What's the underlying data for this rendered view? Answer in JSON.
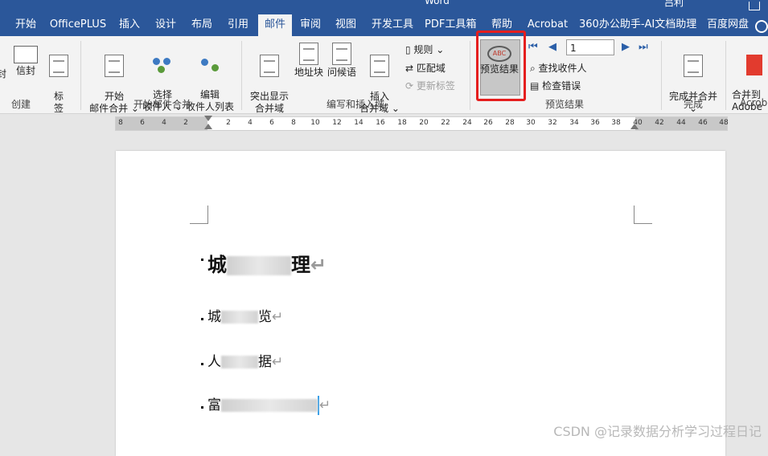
{
  "titlebar": {
    "doc_name": "Word",
    "user": "吕利"
  },
  "tabs": [
    "开始",
    "OfficePLUS",
    "插入",
    "设计",
    "布局",
    "引用",
    "邮件",
    "审阅",
    "视图",
    "开发工具",
    "PDF工具箱",
    "帮助",
    "Acrobat",
    "360办公助手-AI文档助理",
    "百度网盘"
  ],
  "active_tab": "邮件",
  "ribbon": {
    "create_group": {
      "label": "创建",
      "envelope": "信封",
      "labels_btn": "标\n签",
      "partial": "封"
    },
    "start_merge_group": {
      "label": "开始邮件合并",
      "start_merge": "开始\n邮件合并 ⌄",
      "select_recipients": "选择\n收件人 ⌄",
      "edit_list": "编辑\n收件人列表"
    },
    "write_insert_group": {
      "label": "编写和插入域",
      "highlight": "突出显示\n合并域",
      "address_block": "地址块",
      "greeting": "问候语",
      "insert_field": "插入\n合并域 ⌄",
      "rules": "规则 ⌄",
      "match_fields": "匹配域",
      "update_labels": "更新标签"
    },
    "preview_group": {
      "label": "预览结果",
      "preview_btn": "预览结果",
      "record": "1",
      "find_recipient": "查找收件人",
      "check_errors": "检查错误"
    },
    "finish_group": {
      "label": "完成",
      "finish_merge": "完成并合并\n⌄"
    },
    "adobe_group": {
      "label": "Acrob",
      "merge_to_adobe": "合并到\nAdobe"
    }
  },
  "ruler": {
    "ticks": [
      "8",
      "6",
      "4",
      "2",
      "2",
      "4",
      "6",
      "8",
      "10",
      "12",
      "14",
      "16",
      "18",
      "20",
      "22",
      "24",
      "26",
      "28",
      "30",
      "32",
      "34",
      "36",
      "38",
      "40",
      "42",
      "44",
      "46",
      "48"
    ]
  },
  "document": {
    "heading": {
      "start": "城",
      "end": "理"
    },
    "line1": {
      "start": "城",
      "end": "览"
    },
    "line2": {
      "start": "人",
      "end": "据"
    },
    "line3": {
      "start": "富",
      "end": ""
    }
  },
  "watermark": "CSDN @记录数据分析学习过程日记",
  "colors": {
    "tab_bar": "#2b579a",
    "ribbon": "#f3f3f3",
    "highlight_box": "#e51e1e"
  }
}
